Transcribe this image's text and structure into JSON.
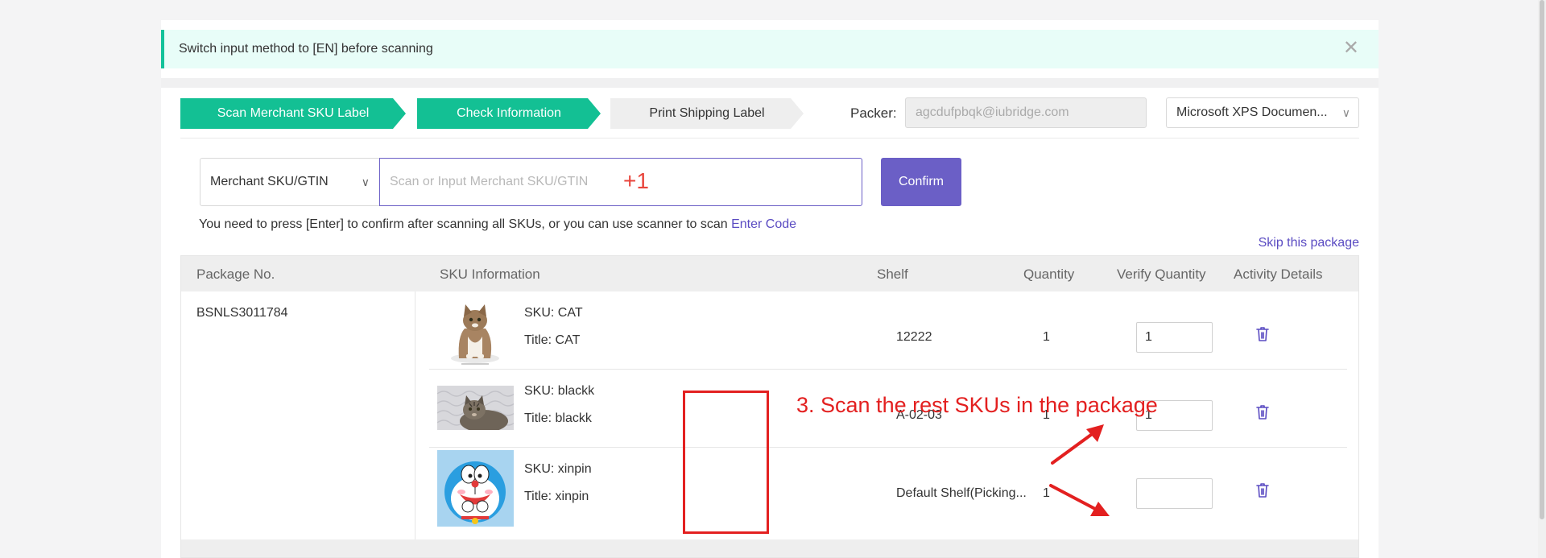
{
  "notice": {
    "text": "Switch input method to [EN] before scanning",
    "close": "✕"
  },
  "steps": [
    {
      "label": "Scan Merchant SKU Label"
    },
    {
      "label": "Check Information"
    },
    {
      "label": "Print Shipping Label"
    }
  ],
  "packer": {
    "label": "Packer:",
    "value": "agcdufpbqk@iubridge.com"
  },
  "printer": {
    "value": "Microsoft XPS Documen..."
  },
  "scan": {
    "type_value": "Merchant SKU/GTIN",
    "placeholder": "Scan or Input Merchant SKU/GTIN",
    "confirm_label": "Confirm",
    "plus_one": "+1"
  },
  "hint": {
    "text": "You need to press [Enter] to confirm after scanning all SKUs, or you can use scanner to scan ",
    "link": "Enter Code"
  },
  "skip_label": "Skip this package",
  "table": {
    "headers": [
      "Package No.",
      "SKU Information",
      "Shelf",
      "Quantity",
      "Verify Quantity",
      "Activity Details"
    ],
    "package_no": "BSNLS3011784",
    "rows": [
      {
        "sku": "SKU: CAT",
        "title": "Title: CAT",
        "shelf": "12222",
        "quantity": "1",
        "verify": "1",
        "image": "cat-photo"
      },
      {
        "sku": "SKU: blackk",
        "title": "Title: blackk",
        "shelf": "A-02-03",
        "quantity": "1",
        "verify": "1",
        "image": "tabby-cat-photo"
      },
      {
        "sku": "SKU: xinpin",
        "title": "Title: xinpin",
        "shelf": "Default Shelf(Picking...",
        "quantity": "1",
        "verify": "",
        "image": "doraemon-image"
      }
    ]
  },
  "annotation": {
    "text": "3. Scan the rest SKUs in the package",
    "color": "#e32020"
  },
  "colors": {
    "accent_green": "#13c094",
    "accent_purple": "#6b5fc6"
  }
}
